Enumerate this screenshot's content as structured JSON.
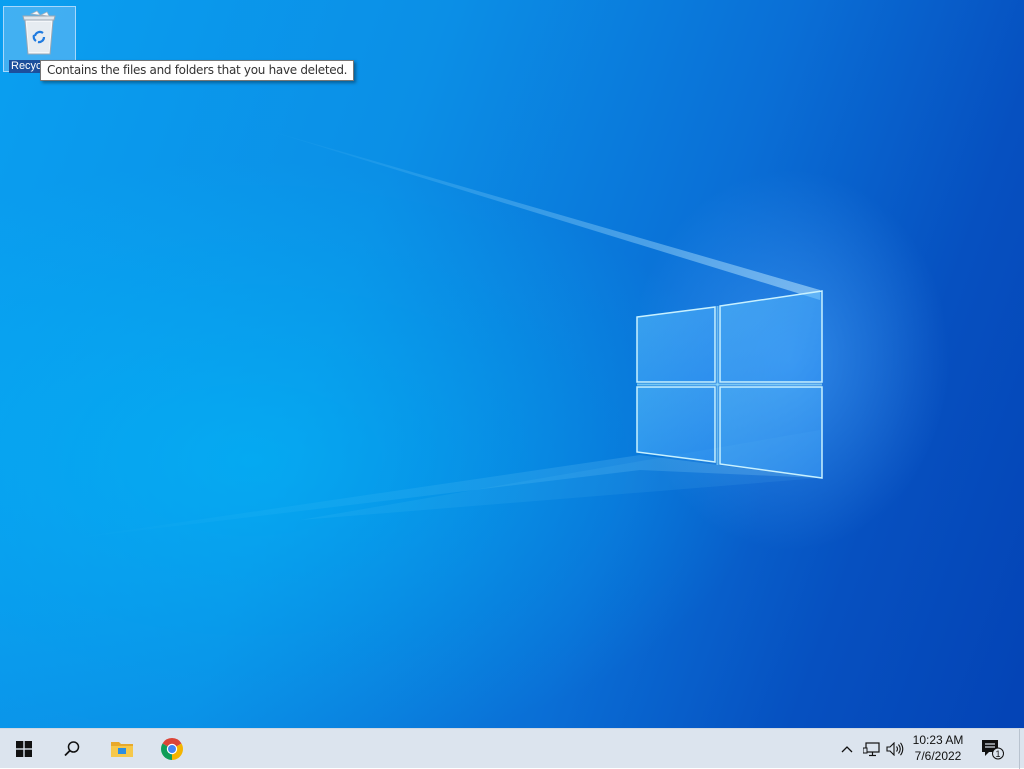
{
  "desktop": {
    "icons": [
      {
        "label": "Recycle Bin",
        "label_visible": "Recyc",
        "icon": "recycle-bin-icon"
      }
    ],
    "tooltip": "Contains the files and folders that you have deleted."
  },
  "taskbar": {
    "buttons": [
      {
        "name": "start",
        "icon": "windows-logo-icon"
      },
      {
        "name": "search",
        "icon": "search-icon"
      },
      {
        "name": "file-explorer",
        "icon": "folder-icon"
      },
      {
        "name": "chrome",
        "icon": "chrome-icon"
      }
    ],
    "tray": {
      "icons": [
        "chevron-up-icon",
        "network-icon",
        "volume-icon"
      ],
      "time": "10:23 AM",
      "date": "7/6/2022",
      "notification_count": "1"
    }
  },
  "colors": {
    "wallpaper_blue": "#0a8de6",
    "taskbar_bg": "#dce4ee",
    "chrome_red": "#db4437",
    "chrome_yellow": "#f4b400",
    "chrome_green": "#0f9d58",
    "chrome_blue": "#4285f4",
    "folder_yellow": "#f3c233"
  }
}
